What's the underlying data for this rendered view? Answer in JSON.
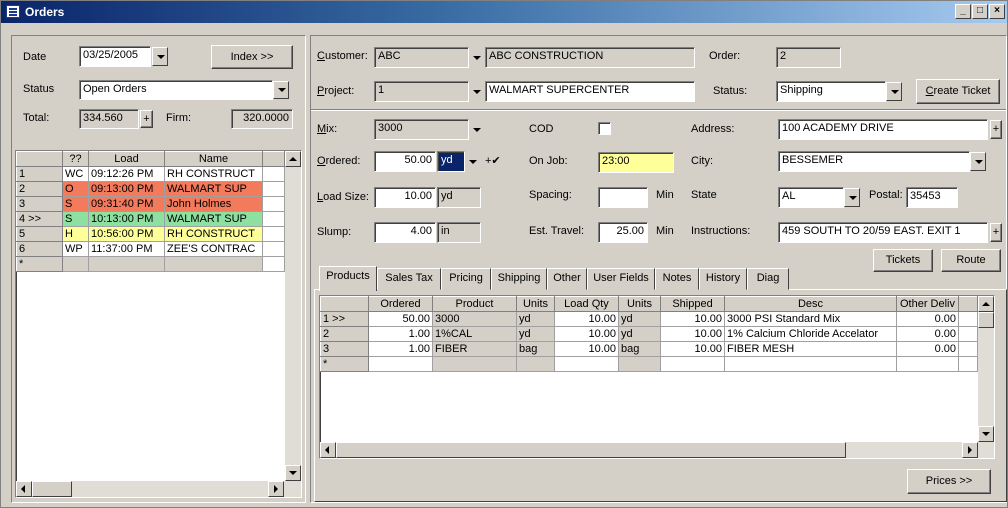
{
  "window": {
    "title": "Orders",
    "min": "_",
    "max": "□",
    "close": "×"
  },
  "left": {
    "date_label": "Date",
    "date_value": "03/25/2005",
    "index_button": "Index >>",
    "status_label": "Status",
    "status_value": "Open Orders",
    "total_label": "Total:",
    "total_value": "334.560",
    "plus_button": "+",
    "firm_label": "Firm:",
    "firm_value": "320.0000",
    "grid": {
      "headers": [
        "",
        "??",
        "Load",
        "Name"
      ],
      "rows": [
        {
          "ind": "1",
          "code": "WC",
          "load": "09:12:26 PM",
          "name": "RH CONSTRUCT",
          "color": "#ffffff"
        },
        {
          "ind": "2",
          "code": "O",
          "load": "09:13:00 PM",
          "name": "WALMART SUP",
          "color": "#f47a5c"
        },
        {
          "ind": "3",
          "code": "S",
          "load": "09:31:40 PM",
          "name": "John Holmes",
          "color": "#f47a5c"
        },
        {
          "ind": "4 >>",
          "code": "S",
          "load": "10:13:00 PM",
          "name": "WALMART SUP",
          "color": "#8ee0a0"
        },
        {
          "ind": "5",
          "code": "H",
          "load": "10:56:00 PM",
          "name": "RH CONSTRUCT",
          "color": "#ffff99"
        },
        {
          "ind": "6",
          "code": "WP",
          "load": "11:37:00 PM",
          "name": "ZEE'S CONTRAC",
          "color": "#ffffff"
        },
        {
          "ind": "*",
          "code": "",
          "load": "",
          "name": "",
          "color": "#d4d0c8"
        }
      ]
    }
  },
  "form": {
    "customer_label": "Customer:",
    "customer_code": "ABC",
    "customer_name": "ABC CONSTRUCTION",
    "order_label": "Order:",
    "order_value": "2",
    "project_label": "Project:",
    "project_code": "1",
    "project_name": "WALMART SUPERCENTER",
    "status_label": "Status:",
    "status_value": "Shipping",
    "create_ticket_button": "Create Ticket",
    "mix_label": "Mix:",
    "mix_value": "3000",
    "cod_label": "COD",
    "address_label": "Address:",
    "address_value": "100 ACADEMY DRIVE",
    "ordered_label": "Ordered:",
    "ordered_value": "50.00",
    "ordered_unit": "yd",
    "ordered_check": "+✔",
    "onjob_label": "On Job:",
    "onjob_value": "23:00",
    "city_label": "City:",
    "city_value": "BESSEMER",
    "loadsize_label": "Load Size:",
    "loadsize_value": "10.00",
    "loadsize_unit": "yd",
    "spacing_label": "Spacing:",
    "spacing_unit": "Min",
    "state_label": "State",
    "state_value": "AL",
    "postal_label": "Postal:",
    "postal_value": "35453",
    "slump_label": "Slump:",
    "slump_value": "4.00",
    "slump_unit": "in",
    "travel_label": "Est. Travel:",
    "travel_value": "25.00",
    "travel_unit": "Min",
    "instructions_label": "Instructions:",
    "instructions_value": "459 SOUTH TO 20/59 EAST.  EXIT 1",
    "tickets_button": "Tickets",
    "route_button": "Route",
    "plus": "+"
  },
  "tabs": [
    "Products",
    "Sales Tax",
    "Pricing",
    "Shipping",
    "Other",
    "User Fields",
    "Notes",
    "History",
    "Diag"
  ],
  "products": {
    "headers": [
      "",
      "Ordered",
      "Product",
      "Units",
      "Load Qty",
      "Units",
      "Shipped",
      "Desc",
      "Other Deliv"
    ],
    "rows": [
      [
        "1 >>",
        "50.00",
        "3000",
        "yd",
        "10.00",
        "yd",
        "10.00",
        "3000 PSI Standard Mix",
        "0.00"
      ],
      [
        "2",
        "1.00",
        "1%CAL",
        "yd",
        "10.00",
        "yd",
        "10.00",
        "1% Calcium Chloride Accelator",
        "0.00"
      ],
      [
        "3",
        "1.00",
        "FIBER",
        "bag",
        "10.00",
        "bag",
        "10.00",
        "FIBER MESH",
        "0.00"
      ],
      [
        "*",
        "",
        "",
        "",
        "",
        "",
        "",
        "",
        ""
      ]
    ]
  },
  "prices_button": "Prices >>"
}
